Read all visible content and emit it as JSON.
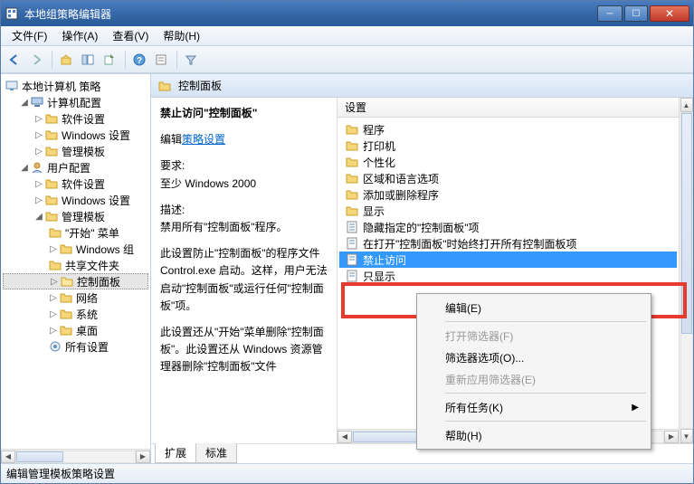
{
  "window": {
    "title": "本地组策略编辑器"
  },
  "menus": {
    "file": "文件(F)",
    "action": "操作(A)",
    "view": "查看(V)",
    "help": "帮助(H)"
  },
  "tree": {
    "root": "本地计算机 策略",
    "computer": "计算机配置",
    "software1": "软件设置",
    "winset1": "Windows 设置",
    "admin1": "管理模板",
    "user": "用户配置",
    "software2": "软件设置",
    "winset2": "Windows 设置",
    "admin2": "管理模板",
    "startmenu": "\"开始\" 菜单",
    "wincomp": "Windows 组",
    "shared": "共享文件夹",
    "cpl": "控制面板",
    "network": "网络",
    "system": "系统",
    "desktop": "桌面",
    "allset": "所有设置"
  },
  "breadcrumb": {
    "label": "控制面板"
  },
  "desc": {
    "heading": "禁止访问\"控制面板\"",
    "editprefix": "编辑",
    "editlink": "策略设置",
    "reqlabel": "要求:",
    "reqvalue": "至少 Windows 2000",
    "desclabel": "描述:",
    "p1": "禁用所有\"控制面板\"程序。",
    "p2": "此设置防止\"控制面板\"的程序文件 Control.exe 启动。这样，用户无法启动\"控制面板\"或运行任何\"控制面板\"项。",
    "p3": "此设置还从\"开始\"菜单删除\"控制面板\"。此设置还从 Windows 资源管理器删除\"控制面板\"文件"
  },
  "listheader": "设置",
  "list": {
    "i0": "程序",
    "i1": "打印机",
    "i2": "个性化",
    "i3": "区域和语言选项",
    "i4": "添加或删除程序",
    "i5": "显示",
    "i6": "隐藏指定的\"控制面板\"项",
    "i7": "在打开\"控制面板\"时始终打开所有控制面板项",
    "i8": "禁止访问",
    "i9": "只显示"
  },
  "contextmenu": {
    "edit": "编辑(E)",
    "openfilter": "打开筛选器(F)",
    "filteropts": "筛选器选项(O)...",
    "reapply": "重新应用筛选器(E)",
    "alltasks": "所有任务(K)",
    "help": "帮助(H)"
  },
  "tabs": {
    "extended": "扩展",
    "standard": "标准"
  },
  "status": "编辑管理模板策略设置"
}
